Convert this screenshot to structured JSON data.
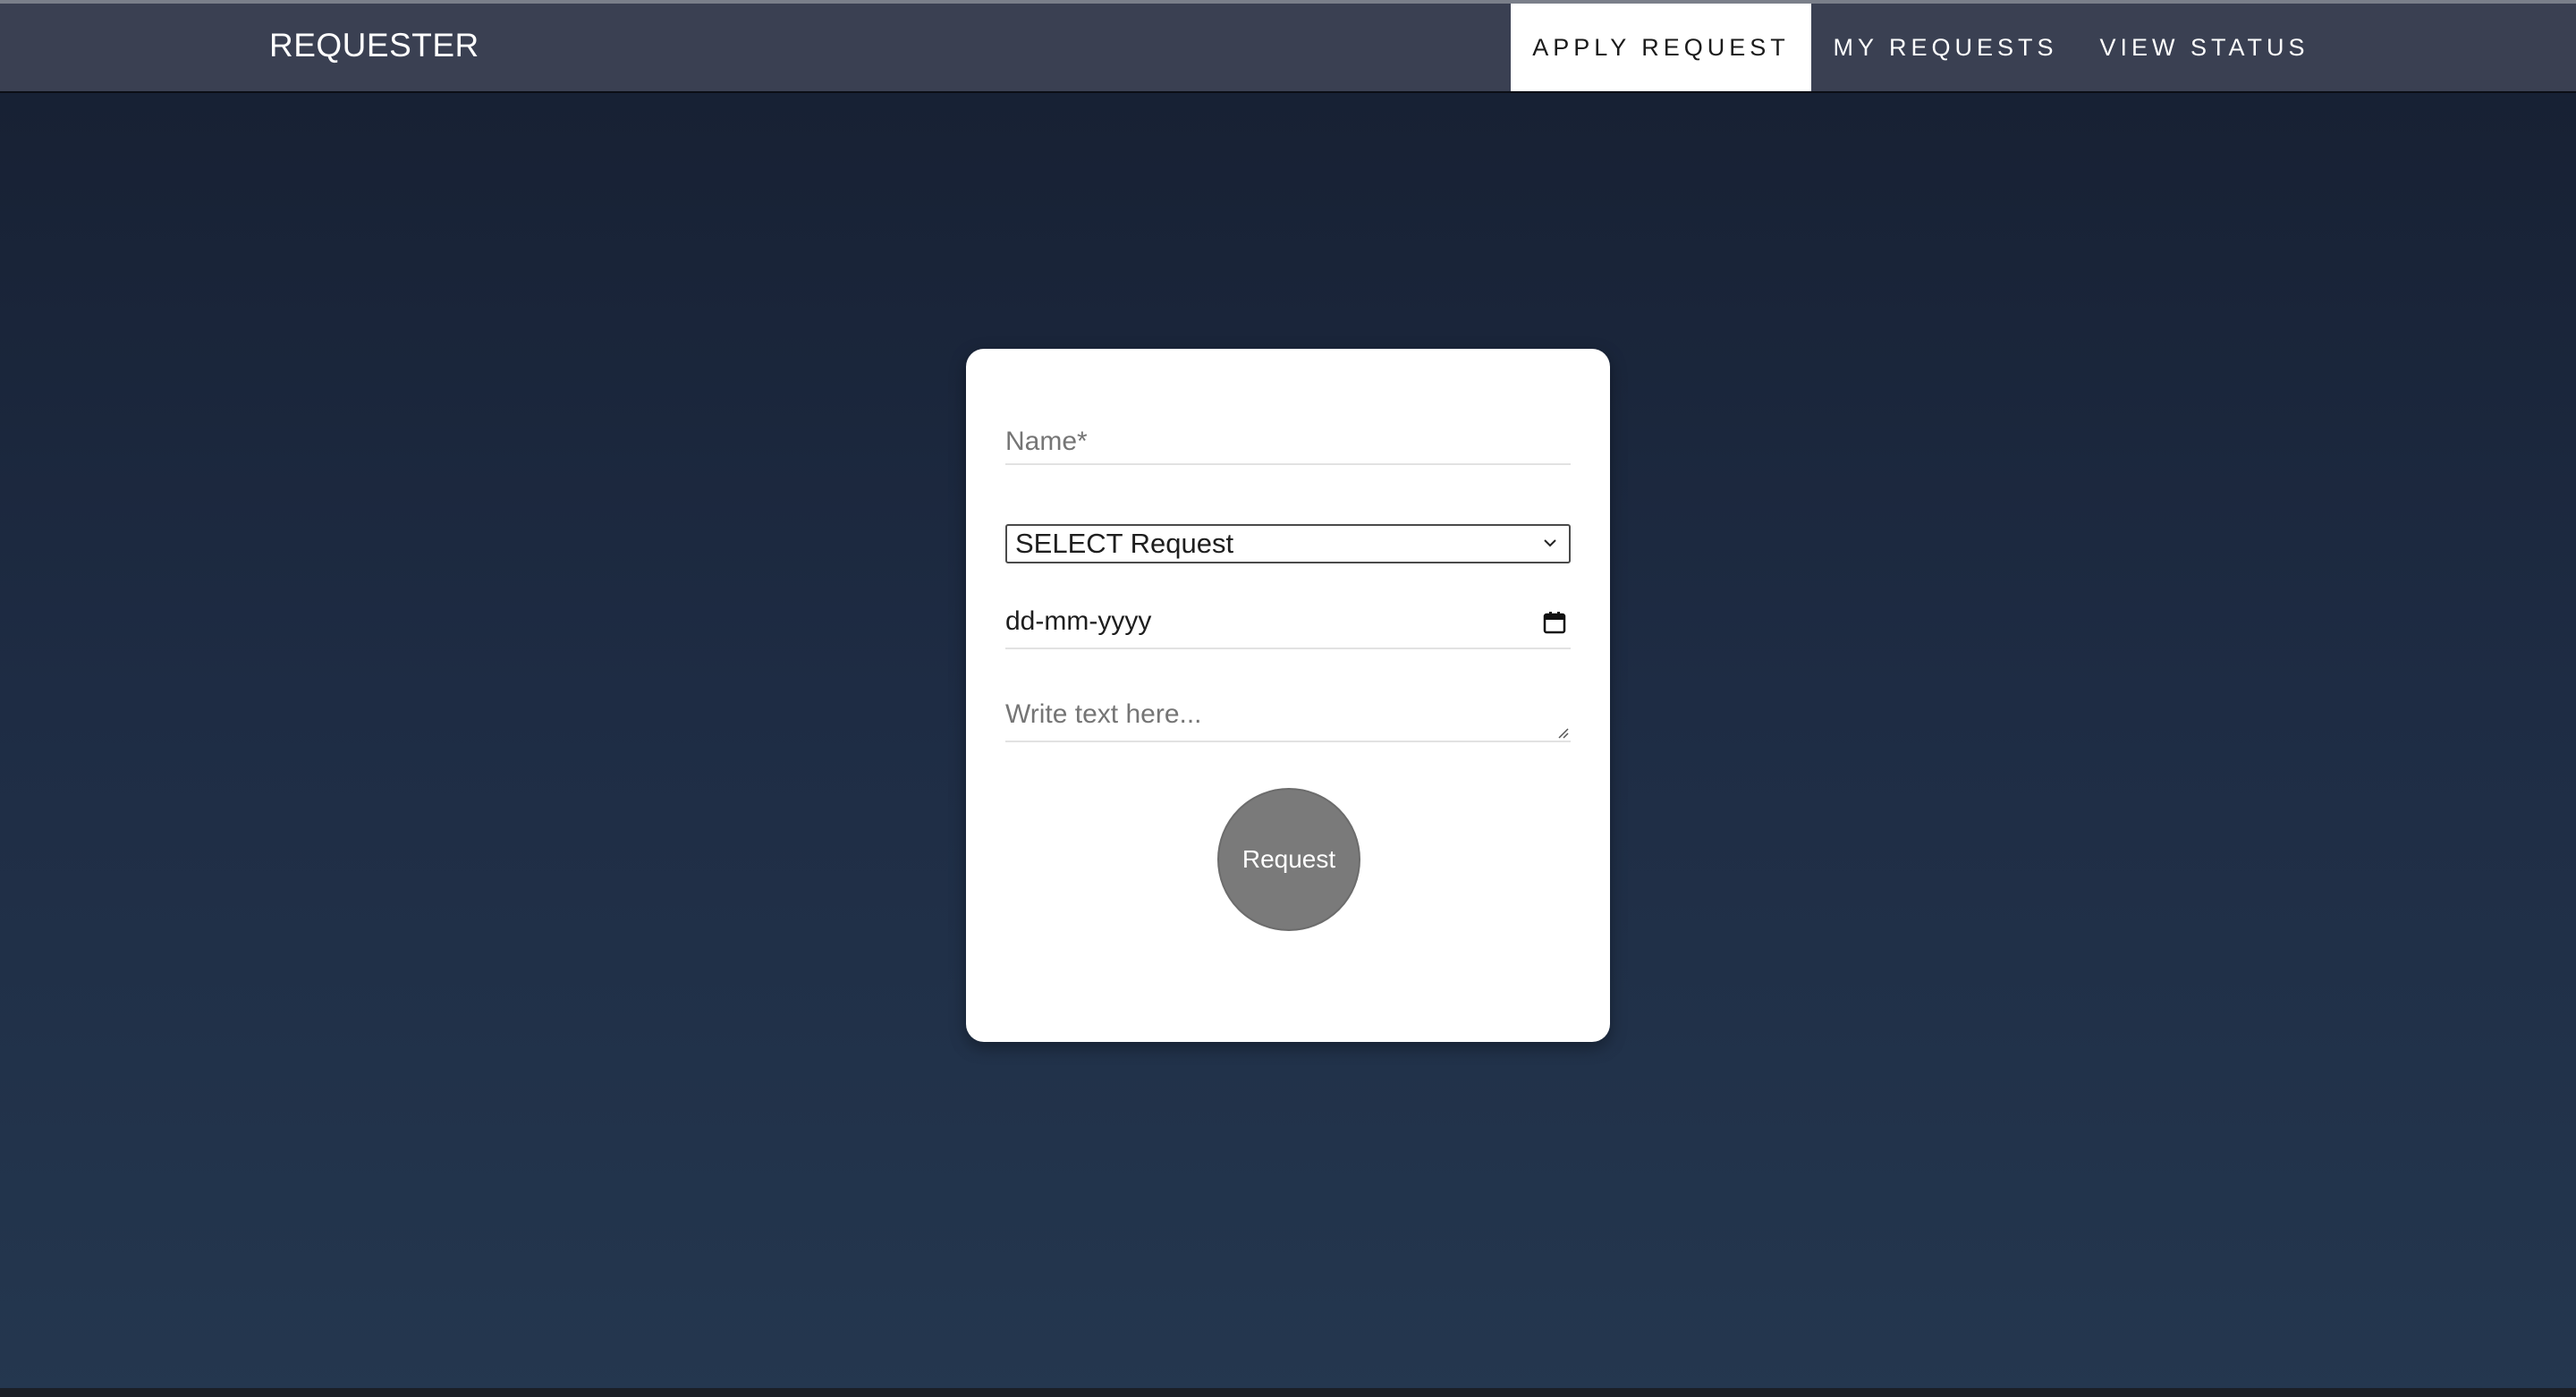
{
  "navbar": {
    "brand": "REQUESTER",
    "items": [
      {
        "label": "APPLY REQUEST",
        "active": true
      },
      {
        "label": "MY REQUESTS",
        "active": false
      },
      {
        "label": "VIEW STATUS",
        "active": false
      }
    ]
  },
  "form": {
    "name_placeholder": "Name*",
    "name_value": "",
    "select_value": "SELECT Request",
    "date_value": "dd-mm-yyyy",
    "text_placeholder": "Write text here...",
    "submit_label": "Request"
  },
  "colors": {
    "navbar_bg": "#3a4052",
    "active_tab_bg": "#ffffff",
    "page_gradient_top": "#161f31",
    "page_gradient_bottom": "#24374f",
    "button_bg": "#7a7a7a"
  },
  "icons": {
    "select": "chevron-down-icon",
    "date": "calendar-icon",
    "textarea": "resize-grip-icon"
  }
}
